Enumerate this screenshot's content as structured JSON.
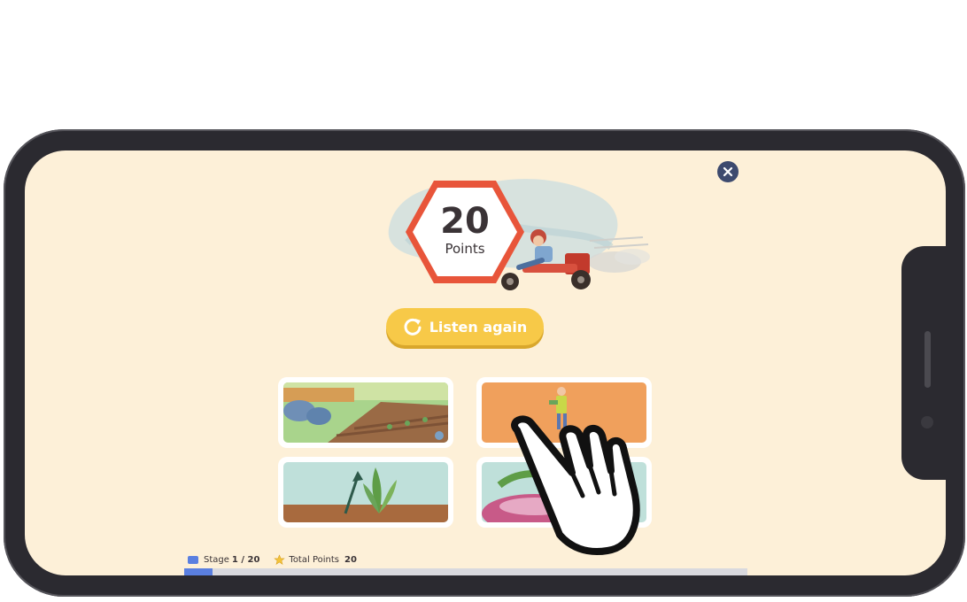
{
  "result": {
    "points_value": "20",
    "points_label": "Points"
  },
  "actions": {
    "listen_again_label": "Listen again"
  },
  "answer_cards": [
    {
      "scene": "vegetable-garden-rows"
    },
    {
      "scene": "child-with-vegetable"
    },
    {
      "scene": "plant-growing-arrow"
    },
    {
      "scene": "turnip-in-soil"
    }
  ],
  "footer": {
    "stage_label": "Stage",
    "stage_value": "1 / 20",
    "total_points_label": "Total Points",
    "total_points_value": "20",
    "progress_fraction": 0.05
  },
  "colors": {
    "screen_bg": "#fdf0d8",
    "accent_yellow": "#f7c948",
    "hexagon_red": "#e8553a",
    "progress_blue": "#5a7fe0"
  },
  "icons": [
    "close-icon",
    "refresh-icon",
    "star-icon",
    "pointing-hand-icon"
  ]
}
